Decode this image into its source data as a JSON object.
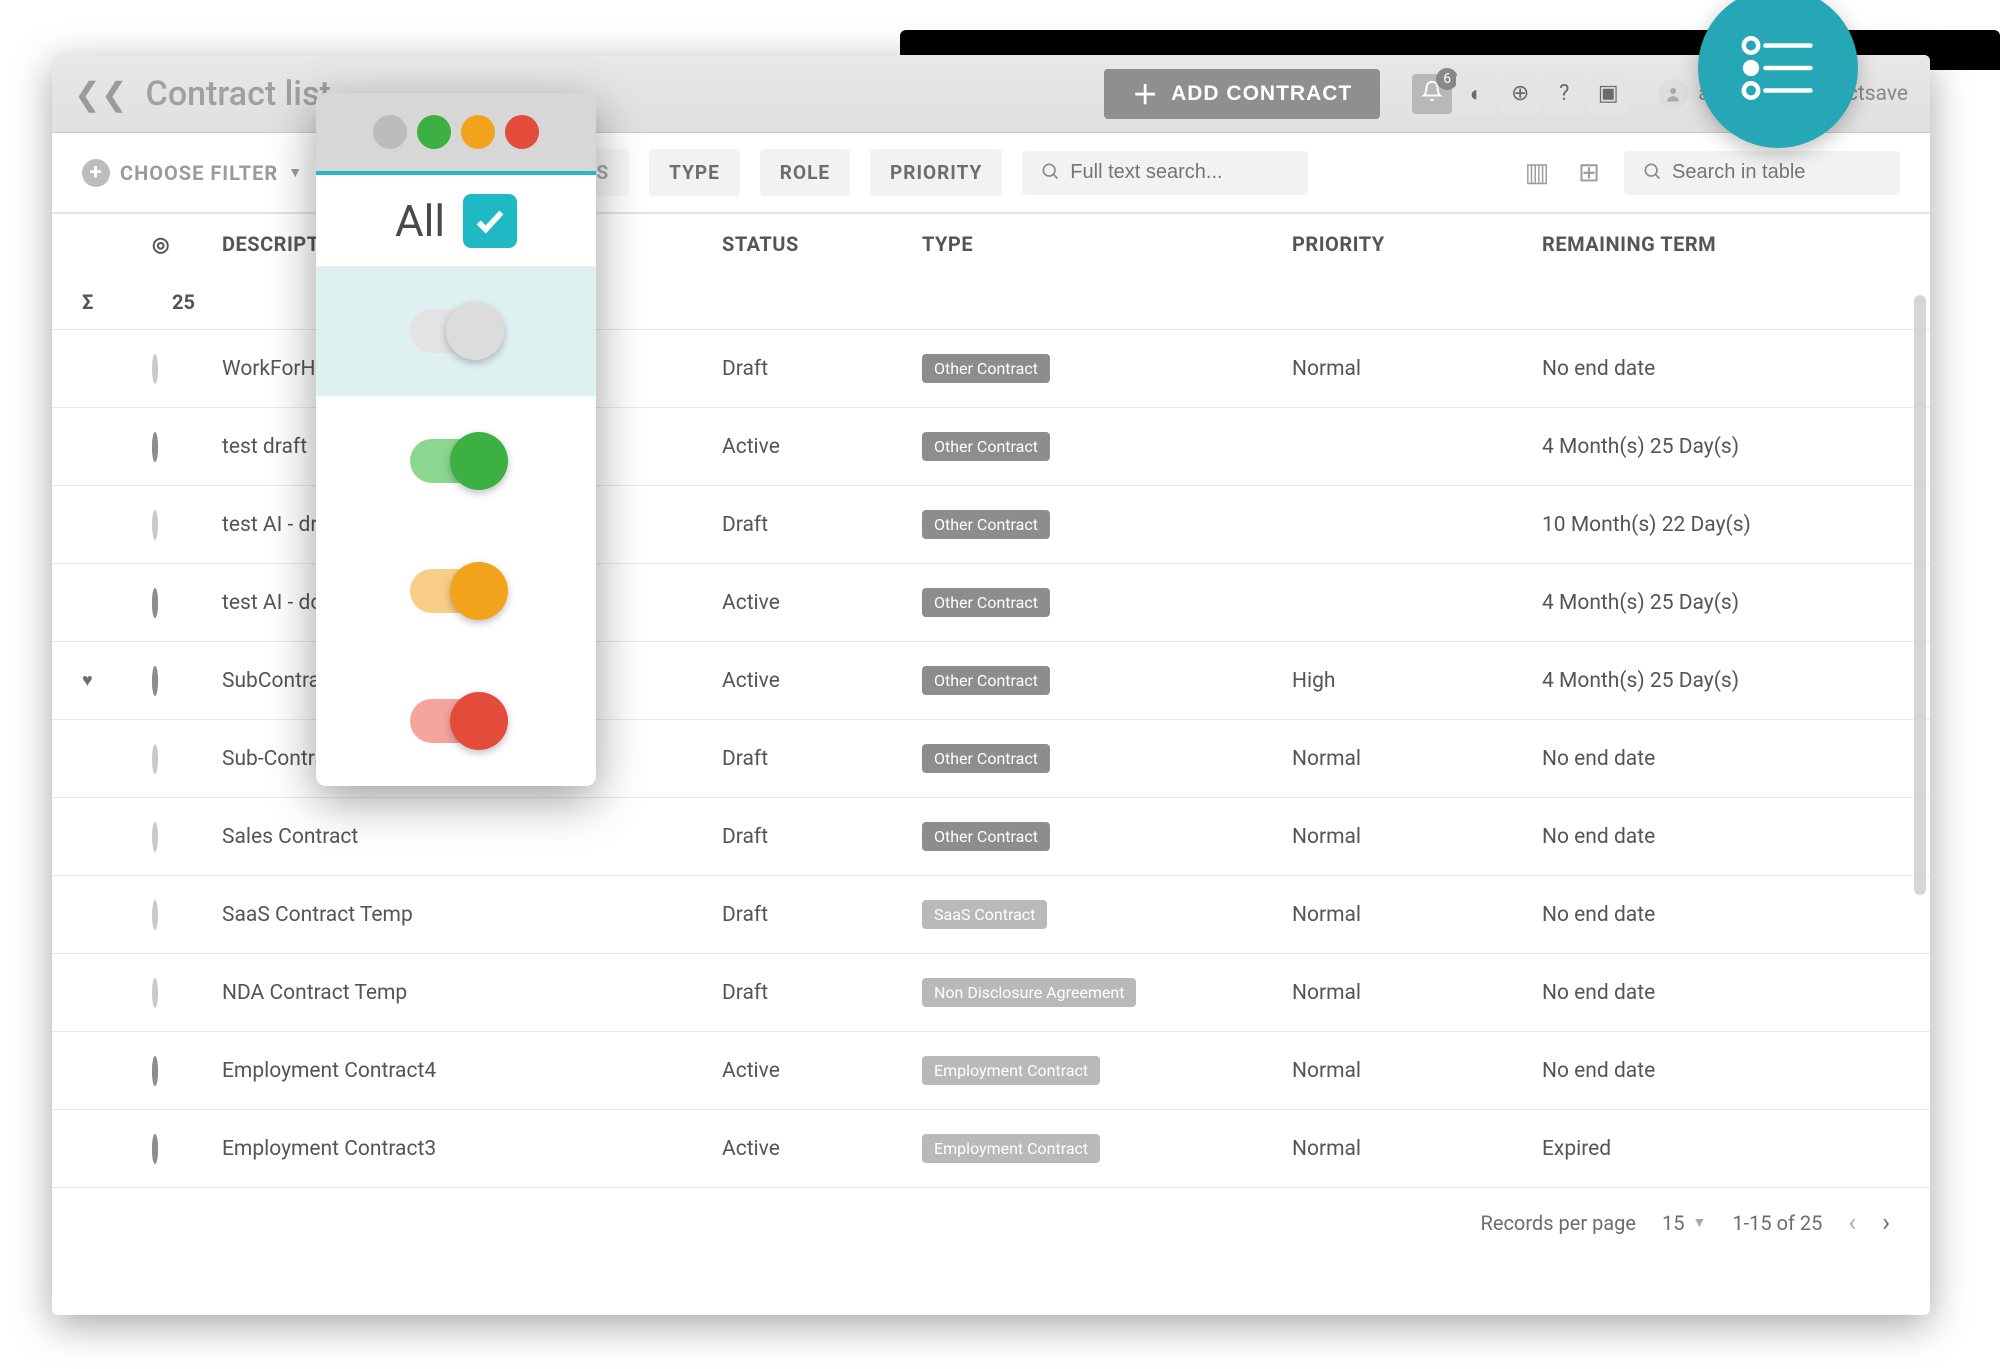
{
  "header": {
    "title": "Contract list",
    "add_button": "ADD CONTRACT",
    "notification_count": "6",
    "user": "admin1@contractsave"
  },
  "filters": {
    "choose_label": "CHOOSE FILTER",
    "pills": {
      "status": "STATUS",
      "type": "TYPE",
      "role": "ROLE",
      "priority": "PRIORITY"
    },
    "full_text_placeholder": "Full text search...",
    "table_search_placeholder": "Search in table"
  },
  "columns": {
    "description": "DESCRIPTION",
    "status": "STATUS",
    "type": "TYPE",
    "priority": "PRIORITY",
    "remaining": "REMAINING TERM"
  },
  "summary": {
    "sigma": "Σ",
    "count": "25"
  },
  "rows": [
    {
      "fav": "",
      "filled": false,
      "desc": "WorkForHire",
      "status": "Draft",
      "type": "Other Contract",
      "type_light": false,
      "priority": "Normal",
      "remain": "No end date"
    },
    {
      "fav": "",
      "filled": true,
      "desc": "test draft",
      "status": "Active",
      "type": "Other Contract",
      "type_light": false,
      "priority": "",
      "remain": "4 Month(s) 25 Day(s)"
    },
    {
      "fav": "",
      "filled": false,
      "desc": "test AI - draft",
      "status": "Draft",
      "type": "Other Contract",
      "type_light": false,
      "priority": "",
      "remain": "10 Month(s) 22 Day(s)"
    },
    {
      "fav": "",
      "filled": true,
      "desc": "test AI - done",
      "status": "Active",
      "type": "Other Contract",
      "type_light": false,
      "priority": "",
      "remain": "4 Month(s) 25 Day(s)"
    },
    {
      "fav": "♥",
      "filled": true,
      "desc": "SubContract",
      "status": "Active",
      "type": "Other Contract",
      "type_light": false,
      "priority": "High",
      "remain": "4 Month(s) 25 Day(s)"
    },
    {
      "fav": "",
      "filled": false,
      "desc": "Sub-Contract",
      "status": "Draft",
      "type": "Other Contract",
      "type_light": false,
      "priority": "Normal",
      "remain": "No end date"
    },
    {
      "fav": "",
      "filled": false,
      "desc": "Sales Contract",
      "status": "Draft",
      "type": "Other Contract",
      "type_light": false,
      "priority": "Normal",
      "remain": "No end date"
    },
    {
      "fav": "",
      "filled": false,
      "desc": "SaaS Contract Temp",
      "status": "Draft",
      "type": "SaaS Contract",
      "type_light": true,
      "priority": "Normal",
      "remain": "No end date"
    },
    {
      "fav": "",
      "filled": false,
      "desc": "NDA Contract Temp",
      "status": "Draft",
      "type": "Non Disclosure Agreement",
      "type_light": true,
      "priority": "Normal",
      "remain": "No end date"
    },
    {
      "fav": "",
      "filled": true,
      "desc": "Employment Contract4",
      "status": "Active",
      "type": "Employment Contract",
      "type_light": true,
      "priority": "Normal",
      "remain": "No end date"
    },
    {
      "fav": "",
      "filled": true,
      "desc": "Employment Contract3",
      "status": "Active",
      "type": "Employment Contract",
      "type_light": true,
      "priority": "Normal",
      "remain": "Expired"
    }
  ],
  "footer": {
    "records_label": "Records per page",
    "page_size": "15",
    "range": "1-15 of 25"
  },
  "popover": {
    "all_label": "All"
  }
}
